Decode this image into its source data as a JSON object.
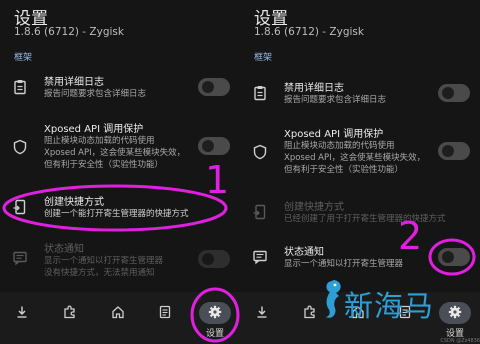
{
  "left": {
    "title": "设置",
    "subtitle": "1.8.6 (6712) - Zygisk",
    "section": "框架",
    "items": [
      {
        "name": "禁用详细日志",
        "desc": [
          "报告问题要求包含详细日志"
        ]
      },
      {
        "name": "Xposed API 调用保护",
        "desc": [
          "阻止模块动态加载的代码使用",
          "Xposed API，这会使某些模块失效，",
          "但有利于安全性（实验性功能）"
        ]
      },
      {
        "name": "创建快捷方式",
        "desc": [
          "创建一个能打开寄生管理器的快捷方式"
        ]
      },
      {
        "name": "状态通知",
        "desc": [
          "显示一个通知以打开寄生管理器",
          "没有快捷方式，无法禁用通知"
        ]
      }
    ],
    "nav_label": "设置"
  },
  "right": {
    "title": "设置",
    "subtitle": "1.8.6 (6712) - Zygisk",
    "section": "框架",
    "items": [
      {
        "name": "禁用详细日志",
        "desc": [
          "报告问题要求包含详细日志"
        ]
      },
      {
        "name": "Xposed API 调用保护",
        "desc": [
          "阻止模块动态加载的代码使用",
          "Xposed API，这会使某些模块失效，",
          "但有利于安全性（实验性功能）"
        ]
      },
      {
        "name": "创建快捷方式",
        "desc": [
          "已经创建了用于打开寄生管理器的快捷方式"
        ]
      },
      {
        "name": "状态通知",
        "desc": [
          "显示一个通知以打开寄生管理器"
        ]
      }
    ],
    "nav_label": "设置"
  },
  "annotations": {
    "step1": "1",
    "step2": "2",
    "brand": "新海马",
    "watermark": "CSDN @Zz4836"
  },
  "icons": [
    "clipboard-icon",
    "shield-icon",
    "shortcut-icon",
    "notification-icon",
    "download-icon",
    "puzzle-icon",
    "home-icon",
    "log-icon",
    "gear-icon"
  ],
  "colors": {
    "background": "#151515",
    "accent": "#8fb8e0",
    "annotation": "#e020e0",
    "brand": "#2e9fd6"
  }
}
